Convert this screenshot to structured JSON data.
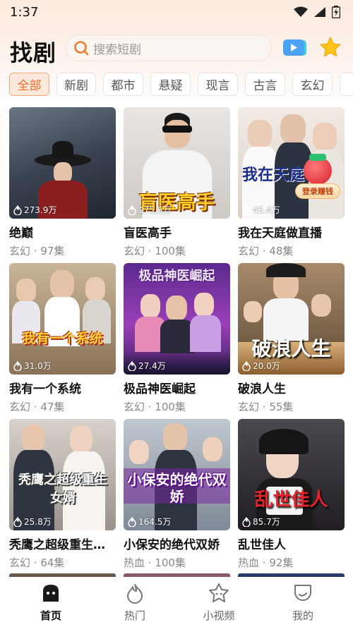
{
  "status_bar": {
    "time": "1:37"
  },
  "header": {
    "title": "找剧",
    "search_placeholder": "搜索短剧"
  },
  "tabs": [
    "全部",
    "新剧",
    "都市",
    "悬疑",
    "现言",
    "古言",
    "玄幻"
  ],
  "dramas": [
    {
      "title": "绝巅",
      "genre": "玄幻",
      "episodes": "97集",
      "views": "273.9万"
    },
    {
      "title": "盲医高手",
      "genre": "玄幻",
      "episodes": "100集",
      "views": "275.5万",
      "poster_text": "盲医高手"
    },
    {
      "title": "我在天庭做直播",
      "genre": "玄幻",
      "episodes": "48集",
      "views": "45.4万",
      "poster_text": "我在天庭",
      "badge": "登录赚钱"
    },
    {
      "title": "我有一个系统",
      "genre": "玄幻",
      "episodes": "47集",
      "views": "31.0万",
      "poster_text": "我有一个系统"
    },
    {
      "title": "极品神医崛起",
      "genre": "玄幻",
      "episodes": "100集",
      "views": "27.4万",
      "poster_text": "极品神医崛起"
    },
    {
      "title": "破浪人生",
      "genre": "玄幻",
      "episodes": "55集",
      "views": "20.0万",
      "poster_text": "破浪人生"
    },
    {
      "title": "秃鹰之超级重生女婿",
      "genre": "玄幻",
      "episodes": "64集",
      "views": "25.8万",
      "poster_text": "秃鹰之超级重生女婿"
    },
    {
      "title": "小保安的绝代双娇",
      "genre": "热血",
      "episodes": "100集",
      "views": "164.5万",
      "poster_text": "小保安的绝代双娇"
    },
    {
      "title": "乱世佳人",
      "genre": "热血",
      "episodes": "92集",
      "views": "85.7万",
      "poster_text": "乱世佳人"
    }
  ],
  "meta_separator": " · ",
  "bottom_nav": [
    "首页",
    "热门",
    "小视频",
    "我的"
  ],
  "colors": {
    "accent": "#f06b2c",
    "accent_bg": "#fde9dc"
  }
}
